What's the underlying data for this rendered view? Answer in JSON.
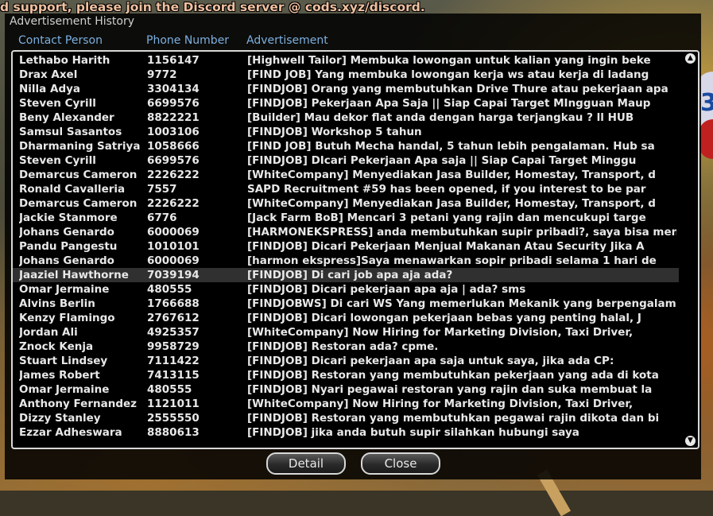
{
  "top_message": "d support, please join the Discord server @ cods.xyz/discord.",
  "dialog": {
    "title": "Advertisement History",
    "columns": [
      "Contact Person",
      "Phone Number",
      "Advertisement"
    ],
    "selected_index": 15,
    "rows": [
      {
        "name": "Lethabo Harith",
        "phone": "1156147",
        "ad": "[Highwell Tailor] Membuka lowongan untuk kalian yang ingin beke"
      },
      {
        "name": "Drax Axel",
        "phone": "9772",
        "ad": "[FIND JOB] Yang membuka lowongan kerja ws atau kerja di ladang"
      },
      {
        "name": "Nilla Adya",
        "phone": "3304134",
        "ad": "[FINDJOB] Orang yang membutuhkan Drive Thure atau pekerjaan apa"
      },
      {
        "name": "Steven Cyrill",
        "phone": "6699576",
        "ad": "[FINDJOB] Pekerjaan Apa Saja || Siap Capai Target MIngguan Maup"
      },
      {
        "name": "Beny Alexander",
        "phone": "8822221",
        "ad": "[Builder] Mau dekor flat anda dengan harga terjangkau ? ll HUB"
      },
      {
        "name": "Samsul Sasantos",
        "phone": "1003106",
        "ad": "[FINDJOB] Workshop 5 tahun"
      },
      {
        "name": "Dharmaning Satriya",
        "phone": "1058666",
        "ad": "[FIND JOB] Butuh Mecha handal, 5 tahun lebih pengalaman. Hub sa"
      },
      {
        "name": "Steven Cyrill",
        "phone": "6699576",
        "ad": "[FINDJOB] DIcari Pekerjaan Apa saja || Siap Capai Target Minggu"
      },
      {
        "name": "Demarcus Cameron",
        "phone": "2226222",
        "ad": "[WhiteCompany] Menyediakan Jasa Builder, Homestay, Transport, d"
      },
      {
        "name": "Ronald Cavalleria",
        "phone": "7557",
        "ad": "SAPD Recruitment #59 has been opened, if you interest to be par"
      },
      {
        "name": "Demarcus Cameron",
        "phone": "2226222",
        "ad": "[WhiteCompany] Menyediakan Jasa Builder, Homestay, Transport, d"
      },
      {
        "name": "Jackie Stanmore",
        "phone": "6776",
        "ad": "[Jack Farm BoB] Mencari 3 petani yang rajin dan mencukupi targe"
      },
      {
        "name": "Johans Genardo",
        "phone": "6000069",
        "ad": "[HARMONEKSPRESS] anda membutuhkan supir pribadi?, saya bisa men"
      },
      {
        "name": "Pandu Pangestu",
        "phone": "1010101",
        "ad": "[FINDJOB] Dicari Pekerjaan Menjual Makanan Atau Security Jika A"
      },
      {
        "name": "Johans Genardo",
        "phone": "6000069",
        "ad": "[harmon ekspress]Saya menawarkan sopir pribadi selama 1 hari de"
      },
      {
        "name": "Jaaziel Hawthorne",
        "phone": "7039194",
        "ad": "[FINDJOB] Di cari job apa aja ada?"
      },
      {
        "name": "Omar Jermaine",
        "phone": "480555",
        "ad": "[FINDJOB] Dicari pekerjaan apa aja | ada? sms"
      },
      {
        "name": "Alvins Berlin",
        "phone": "1766688",
        "ad": "[FINDJOBWS] Di cari WS Yang memerlukan Mekanik yang berpengalam"
      },
      {
        "name": "Kenzy Flamingo",
        "phone": "2767612",
        "ad": "[FINDJOB] Dicari lowongan pekerjaan bebas yang penting halal, J"
      },
      {
        "name": "Jordan Ali",
        "phone": "4925357",
        "ad": "[WhiteCompany] Now Hiring for Marketing Division, Taxi Driver,"
      },
      {
        "name": "Znock Kenja",
        "phone": "9958729",
        "ad": "[FINDJOB] Restoran ada? cpme."
      },
      {
        "name": "Stuart Lindsey",
        "phone": "7111422",
        "ad": "[FINDJOB] Dicari pekerjaan apa saja untuk saya, jika ada CP:"
      },
      {
        "name": "James Robert",
        "phone": "7413115",
        "ad": "[FINDJOB] Restoran yang membutuhkan pekerjaan yang ada di kota"
      },
      {
        "name": "Omar Jermaine",
        "phone": "480555",
        "ad": "[FINDJOB] Nyari pegawai restoran yang rajin dan suka membuat la"
      },
      {
        "name": "Anthony Fernandez",
        "phone": "1121011",
        "ad": "[WhiteCompany] Now Hiring for Marketing Division, Taxi Driver,"
      },
      {
        "name": "Dizzy Stanley",
        "phone": "2555550",
        "ad": "[FINDJOB] Restoran yang membutuhkan pegawai rajin dikota dan bi"
      },
      {
        "name": "Ezzar Adheswara",
        "phone": "8880613",
        "ad": "[FINDJOB] jika anda butuh supir silahkan hubungi saya"
      }
    ],
    "buttons": {
      "detail": "Detail",
      "close": "Close"
    },
    "scroll_up_icon": "arrow-up-icon",
    "scroll_down_icon": "arrow-down-icon"
  }
}
